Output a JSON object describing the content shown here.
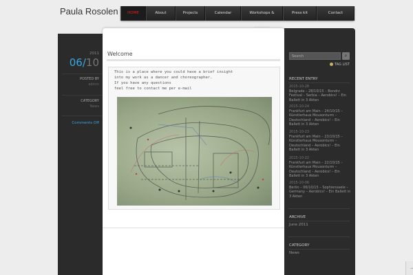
{
  "site": {
    "title": "Paula Rosolen"
  },
  "nav": [
    {
      "label": "HOME",
      "active": true
    },
    {
      "label": "About",
      "active": false
    },
    {
      "label": "Projects",
      "active": false
    },
    {
      "label": "Calendar",
      "active": false
    },
    {
      "label": "Workshops & training",
      "active": false
    },
    {
      "label": "Press kit",
      "active": false
    },
    {
      "label": "Contact",
      "active": false
    }
  ],
  "post_meta": {
    "year": "2011",
    "day": "06",
    "separator": "/",
    "month": "10",
    "posted_by_label": "POSTED BY",
    "author": "admin",
    "category_label": "CATEGORY",
    "category": "News",
    "comments": "Comments Off"
  },
  "post": {
    "title": "Welcome",
    "lines": [
      "This is a place where you could have a brief insight",
      "into my work as a dancer and choreographer.",
      "If you have any questions",
      "feel free to contact me per e-mail"
    ]
  },
  "sidebar": {
    "search_placeholder": "Search",
    "tag_list": "TAG LIST",
    "recent_title": "RECENT ENTRY",
    "recent": [
      {
        "date": "2015-10-28",
        "text": "Belgrade – 28/10/15 – Bondrz Festival – Serbia – Aerobics! – Ein Ballett in 3 Akten"
      },
      {
        "date": "2015-10-24",
        "text": "Frankfurt am Main – 24/10/15 – Künstlerhaus Mousonturm – Deutschland – Aerobics! – Ein Ballett in 3 Akten"
      },
      {
        "date": "2015-10-23",
        "text": "Frankfurt am Main – 23/10/15 – Künstlerhaus Mousonturm – Deutschland – Aerobics! – Ein Ballett in 3 Akten"
      },
      {
        "date": "2015-10-22",
        "text": "Frankfurt am Main – 22/10/15 – Künstlerhaus Mousonturm – Deutschland – Aerobics! – Ein Ballett in 3 Akten"
      },
      {
        "date": "2015-10-06",
        "text": "Berlin – 06/10/15 – Sophiensaele – Germany – Aerobics! – Ein Ballett in 3 Akten"
      }
    ],
    "archive_title": "ARCHIVE",
    "archive": [
      "June 2011"
    ],
    "category_title": "CATEGORY",
    "categories": [
      "News"
    ]
  },
  "colors": {
    "accent": "#3aa7e0",
    "active_nav": "#e02020",
    "dark_panel": "#2b2b2b"
  }
}
